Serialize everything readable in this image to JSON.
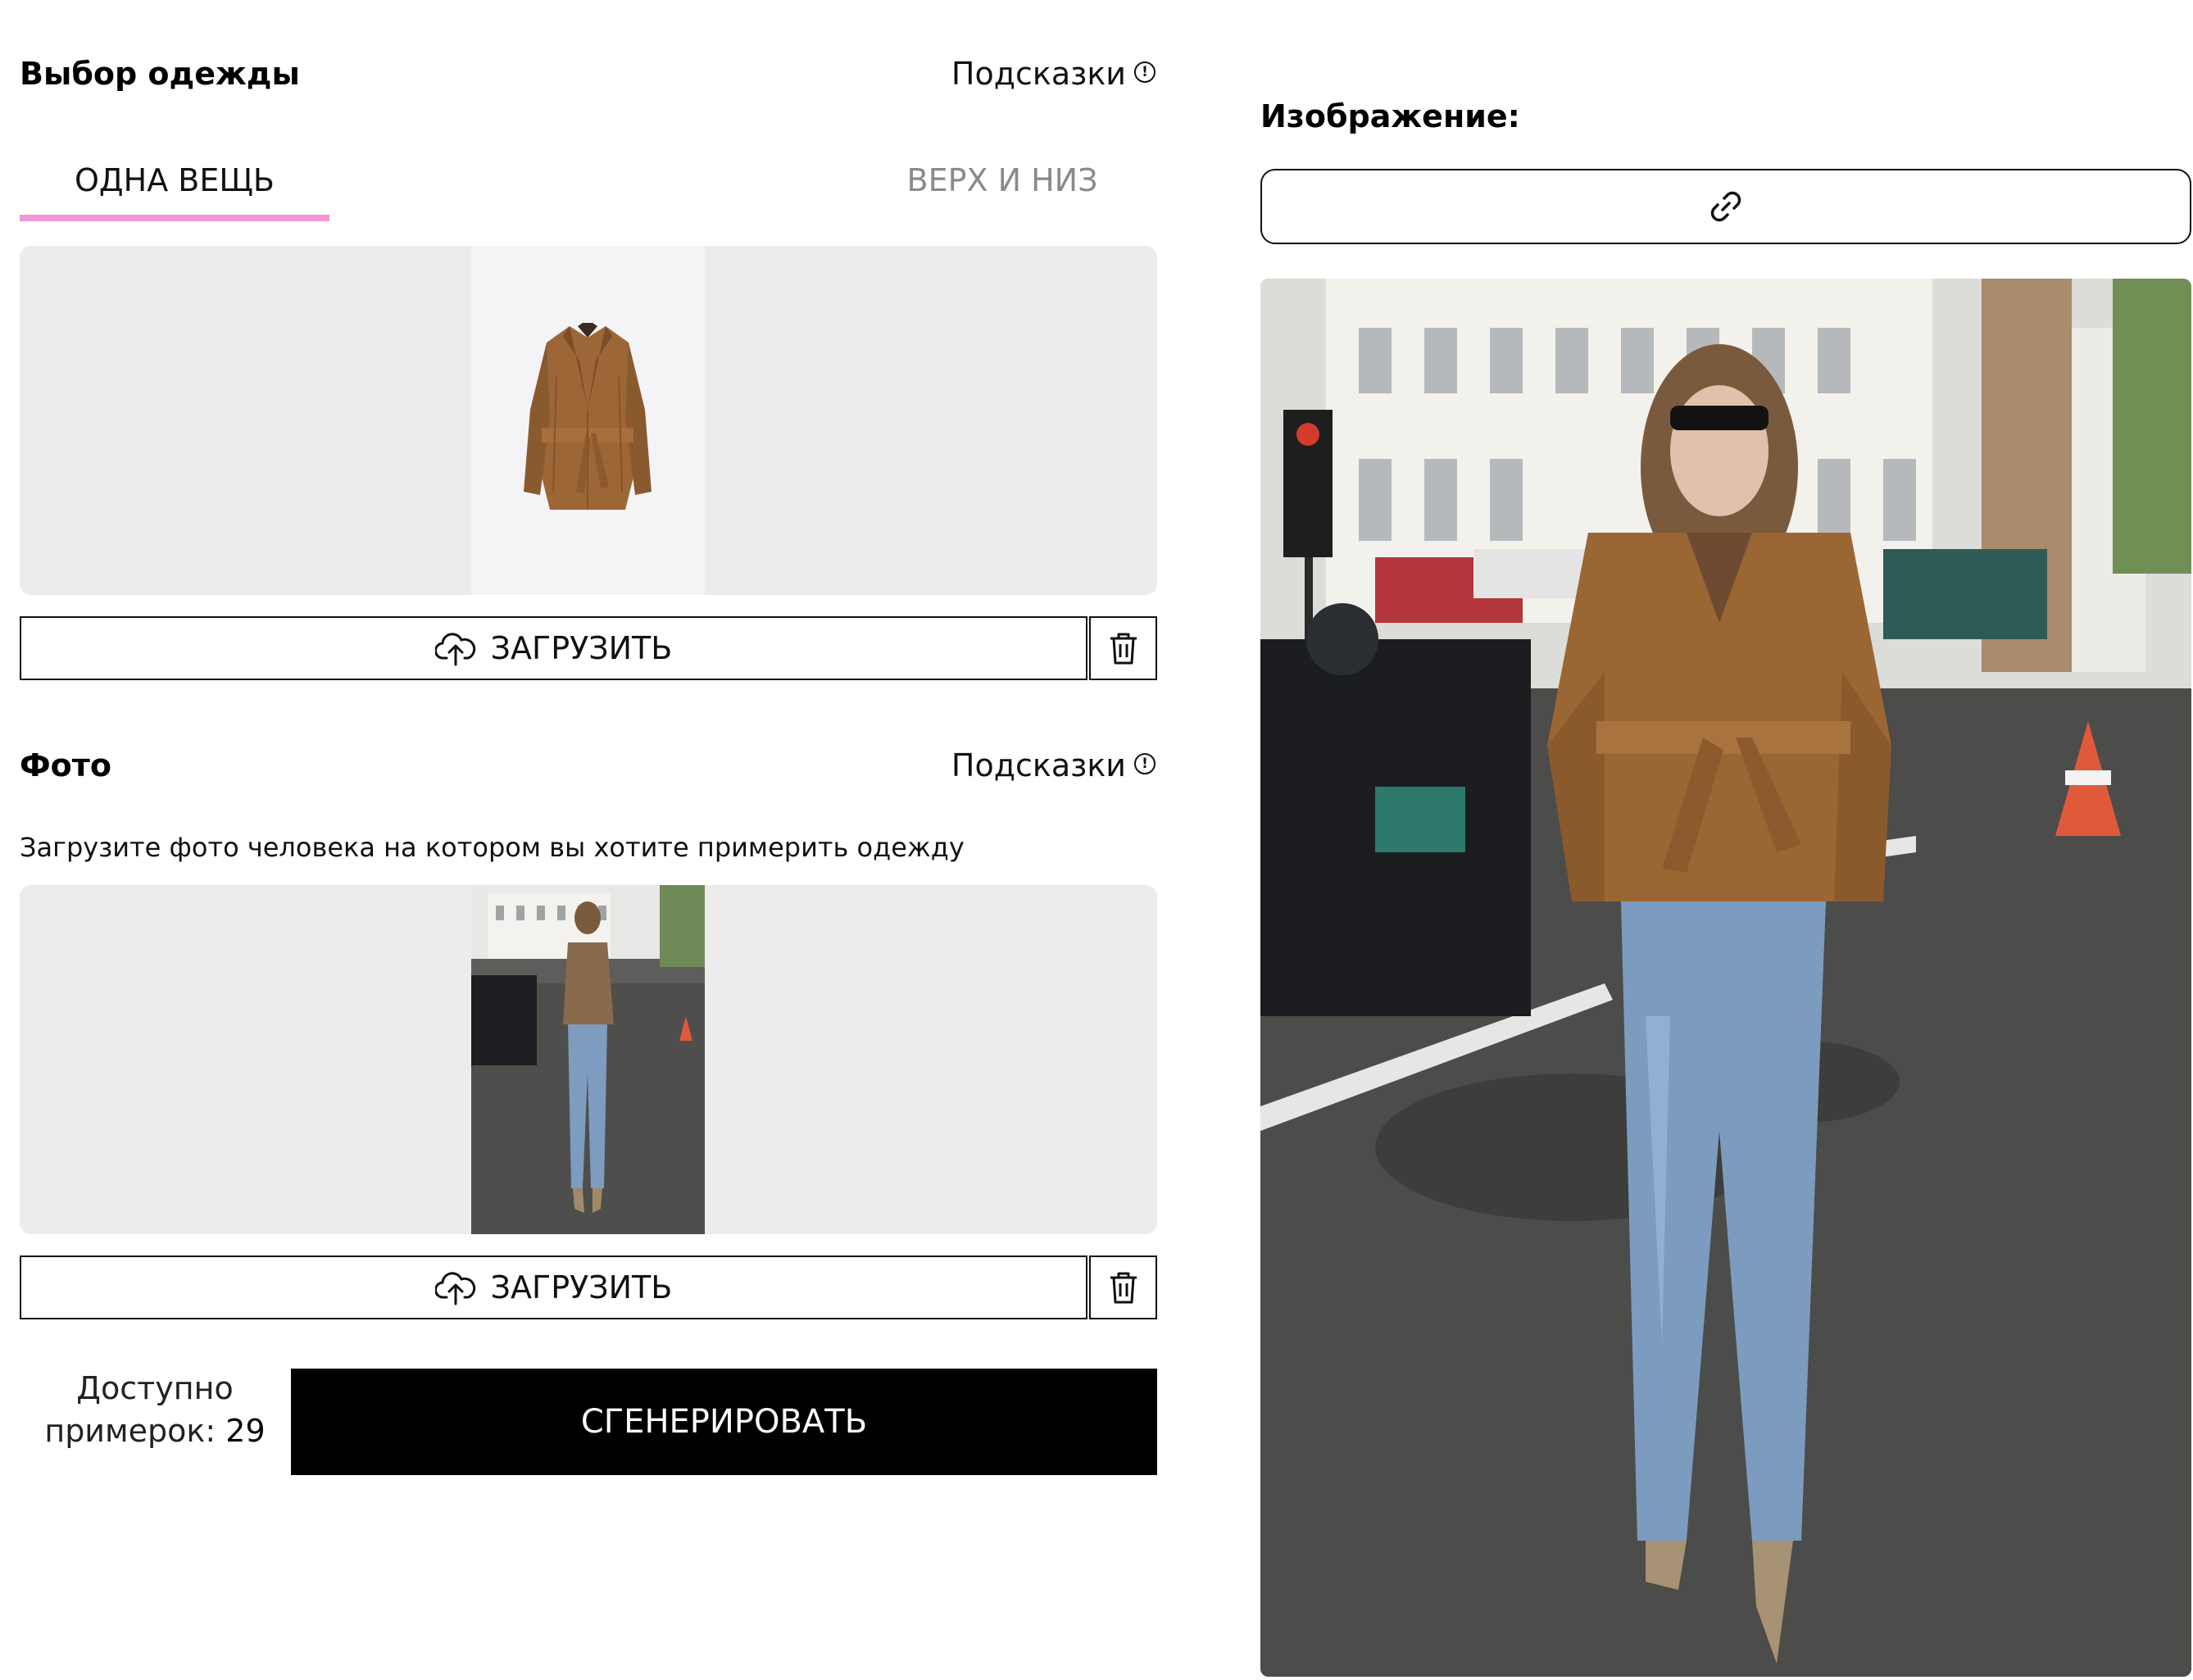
{
  "clothing_section": {
    "title": "Выбор одежды",
    "hints_label": "Подсказки",
    "tabs": [
      {
        "label": "ОДНА ВЕЩЬ",
        "active": true
      },
      {
        "label": "ВЕРХ И НИЗ",
        "active": false
      }
    ],
    "upload_label": "ЗАГРУЗИТЬ"
  },
  "photo_section": {
    "title": "Фото",
    "hints_label": "Подсказки",
    "description": "Загрузите фото человека на котором вы хотите примерить одежду",
    "upload_label": "ЗАГРУЗИТЬ"
  },
  "footer": {
    "tries_line1": "Доступно",
    "tries_line2": "примерок:",
    "tries_count": "29",
    "generate_label": "СГЕНЕРИРОВАТЬ"
  },
  "result": {
    "title": "Изображение:"
  },
  "colors": {
    "accent_underline": "#f097d8",
    "preview_bg": "#ececec",
    "primary_button": "#000000"
  },
  "icons": [
    "info-icon",
    "upload-cloud-icon",
    "trash-icon",
    "link-icon"
  ]
}
